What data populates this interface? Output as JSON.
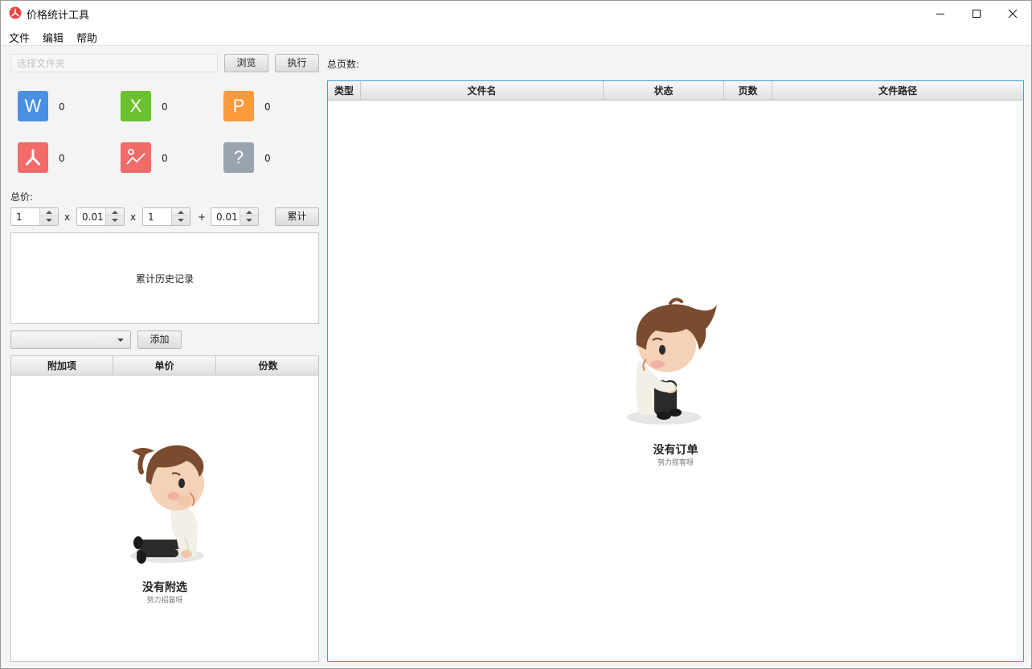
{
  "window": {
    "title": "价格统计工具"
  },
  "menu": [
    "文件",
    "编辑",
    "帮助"
  ],
  "toolbar": {
    "folder_placeholder": "选择文件夹",
    "browse_label": "浏览",
    "execute_label": "执行",
    "total_pages_label": "总页数:"
  },
  "file_types": [
    {
      "glyph": "W",
      "icon": "word-icon",
      "color": "#4a90e2",
      "count": "0"
    },
    {
      "glyph": "X",
      "icon": "excel-icon",
      "color": "#6cc12f",
      "count": "0"
    },
    {
      "glyph": "P",
      "icon": "powerpoint-icon",
      "color": "#fb9a3c",
      "count": "0"
    },
    {
      "glyph": "",
      "icon": "pdf-icon",
      "color": "#f26b6b",
      "count": "0"
    },
    {
      "glyph": "",
      "icon": "image-icon",
      "color": "#f26b6b",
      "count": "0"
    },
    {
      "glyph": "?",
      "icon": "unknown-file-icon",
      "color": "#9aa4b1",
      "count": "0"
    }
  ],
  "pricing": {
    "total_label": "总价:",
    "values": [
      "1",
      "0.01",
      "1",
      "0.01"
    ],
    "ops": [
      "x",
      "x",
      "+"
    ],
    "accumulate_label": "累计",
    "history_label": "累计历史记录"
  },
  "addon": {
    "selected": "",
    "add_label": "添加",
    "columns": [
      "附加项",
      "单价",
      "份数"
    ],
    "empty_title": "没有附选",
    "empty_subtitle": "努力招届呀"
  },
  "files_table": {
    "columns": [
      "类型",
      "文件名",
      "状态",
      "页数",
      "文件路径"
    ],
    "empty_title": "没有订单",
    "empty_subtitle": "努力揽客呀"
  }
}
